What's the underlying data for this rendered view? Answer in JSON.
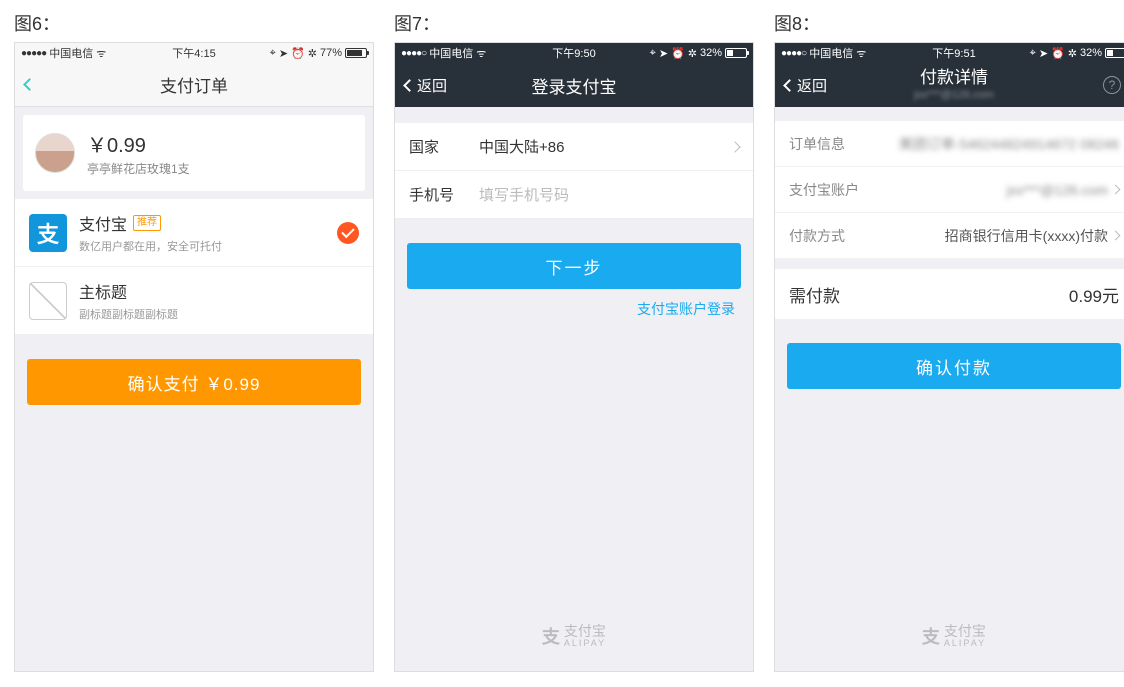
{
  "labels": {
    "s6": "图6：",
    "s7": "图7：",
    "s8": "图8："
  },
  "s6": {
    "status": {
      "carrier": "中国电信",
      "time": "下午4:15",
      "battery_pct": "77%",
      "battery_fill": 77
    },
    "nav": {
      "title": "支付订单"
    },
    "order": {
      "price": "￥0.99",
      "desc": "亭亭鲜花店玫瑰1支"
    },
    "methods": [
      {
        "title": "支付宝",
        "badge": "推荐",
        "sub": "数亿用户都在用，安全可托付",
        "checked": true,
        "type": "alipay",
        "alipay_glyph": "支"
      },
      {
        "title": "主标题",
        "sub": "副标题副标题副标题",
        "checked": false,
        "type": "empty"
      }
    ],
    "confirm": "确认支付 ￥0.99"
  },
  "s7": {
    "status": {
      "carrier": "中国电信",
      "time": "下午9:50",
      "battery_pct": "32%",
      "battery_fill": 32
    },
    "nav": {
      "back": "返回",
      "title": "登录支付宝"
    },
    "country": {
      "label": "国家",
      "value": "中国大陆+86"
    },
    "phone": {
      "label": "手机号",
      "placeholder": "填写手机号码"
    },
    "next": "下一步",
    "alt_login": "支付宝账户登录",
    "brand": {
      "name": "支付宝",
      "en": "ALIPAY",
      "glyph": "支"
    }
  },
  "s8": {
    "status": {
      "carrier": "中国电信",
      "time": "下午9:51",
      "battery_pct": "32%",
      "battery_fill": 32
    },
    "nav": {
      "back": "返回",
      "title": "付款详情",
      "subtitle": "jxx***@126.com"
    },
    "rows": {
      "order": {
        "label": "订单信息",
        "value": "美团订单-546244824914672 08246"
      },
      "account": {
        "label": "支付宝账户",
        "value": "jxx***@126.com"
      },
      "method": {
        "label": "付款方式",
        "value": "招商银行信用卡(xxxx)付款"
      }
    },
    "total": {
      "label": "需付款",
      "value": "0.99元"
    },
    "confirm": "确认付款",
    "brand": {
      "name": "支付宝",
      "en": "ALIPAY",
      "glyph": "支"
    }
  }
}
